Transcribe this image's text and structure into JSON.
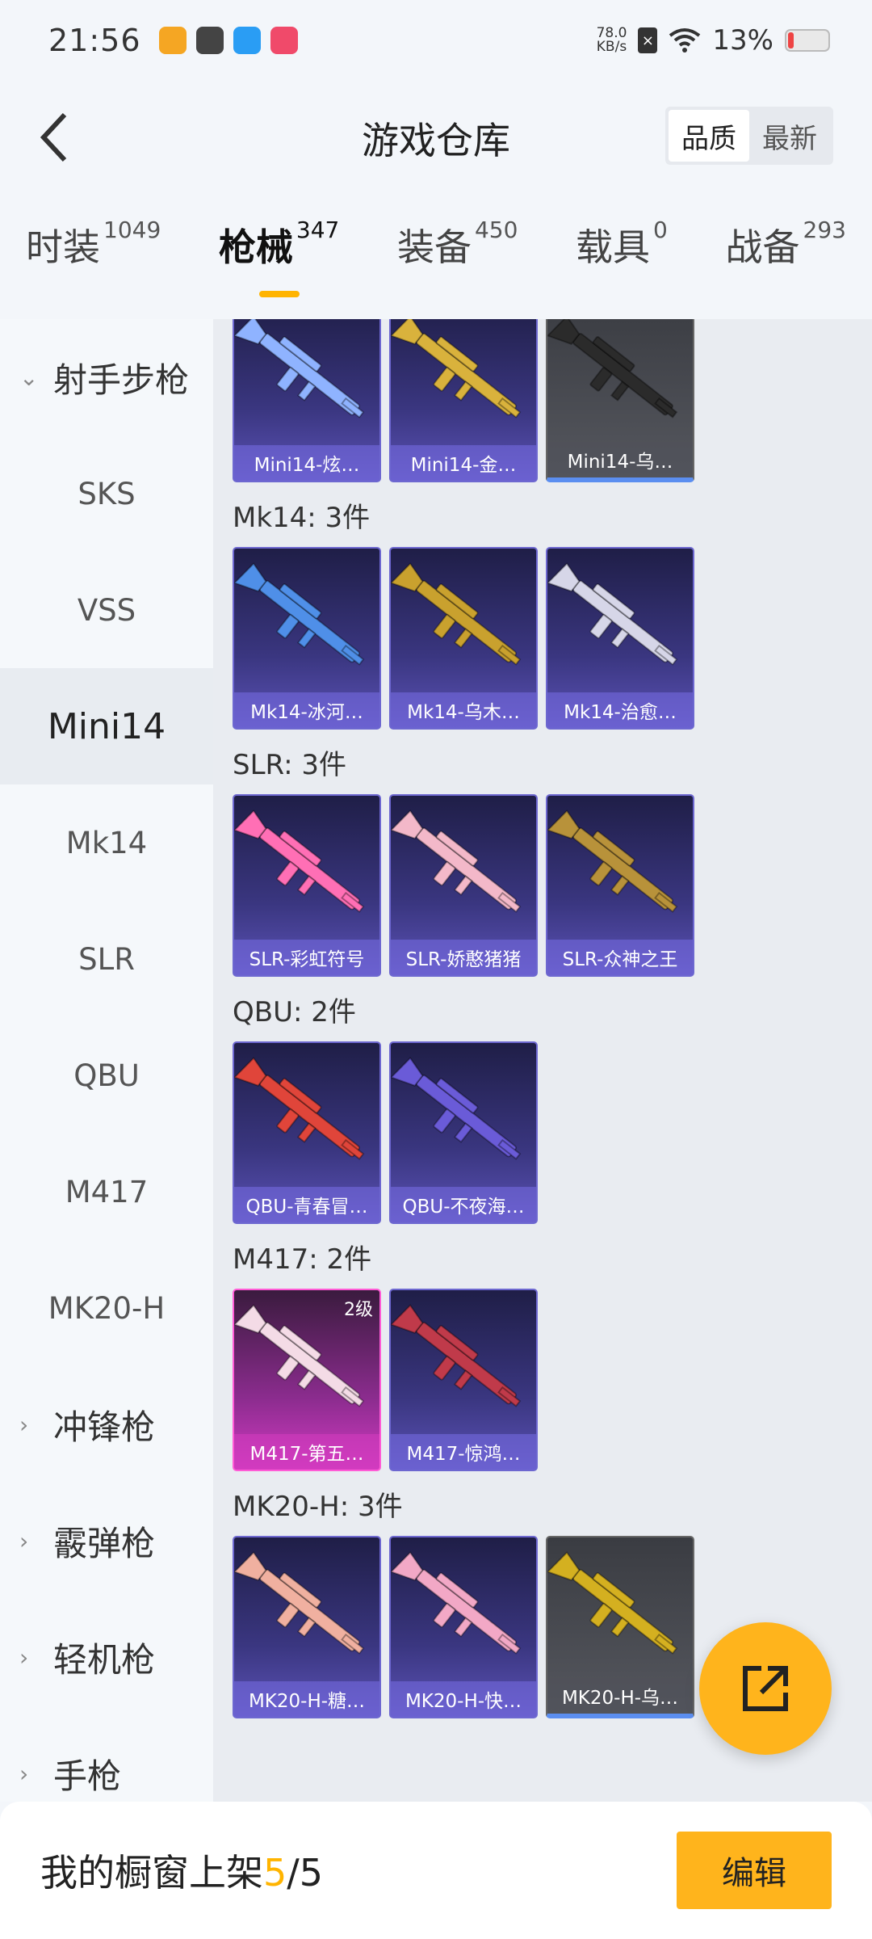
{
  "status_bar": {
    "time": "21:56",
    "net_speed_value": "78.0",
    "net_speed_unit": "KB/s",
    "sim_label": "×",
    "battery": "13%"
  },
  "header": {
    "title": "游戏仓库",
    "sort_options": [
      "品质",
      "最新"
    ],
    "sort_active": "品质"
  },
  "category_tabs": [
    {
      "label": "时装",
      "count": "1049"
    },
    {
      "label": "枪械",
      "count": "347",
      "active": true
    },
    {
      "label": "装备",
      "count": "450"
    },
    {
      "label": "载具",
      "count": "0"
    },
    {
      "label": "战备",
      "count": "293"
    }
  ],
  "sidebar": {
    "items": [
      {
        "label": "射手步枪",
        "type": "group",
        "expanded": true
      },
      {
        "label": "SKS"
      },
      {
        "label": "VSS"
      },
      {
        "label": "Mini14",
        "active": true
      },
      {
        "label": "Mk14"
      },
      {
        "label": "SLR"
      },
      {
        "label": "QBU"
      },
      {
        "label": "M417"
      },
      {
        "label": "MK20-H"
      },
      {
        "label": "冲锋枪",
        "type": "group"
      },
      {
        "label": "霰弹枪",
        "type": "group"
      },
      {
        "label": "轻机枪",
        "type": "group"
      },
      {
        "label": "手枪",
        "type": "group"
      }
    ]
  },
  "sections": [
    {
      "title": "",
      "items": [
        {
          "name": "Mini14-炫…",
          "style": "purple",
          "art": "#8fb3ff"
        },
        {
          "name": "Mini14-金…",
          "style": "purple",
          "art": "#d9b23c"
        },
        {
          "name": "Mini14-乌…",
          "style": "gray",
          "art": "#2b2b2b"
        }
      ]
    },
    {
      "title": "Mk14: 3件",
      "items": [
        {
          "name": "Mk14-冰河…",
          "style": "purple",
          "art": "#4f8fe8"
        },
        {
          "name": "Mk14-乌木…",
          "style": "purple",
          "art": "#c9a12e"
        },
        {
          "name": "Mk14-治愈…",
          "style": "purple",
          "art": "#d6d6e8"
        }
      ]
    },
    {
      "title": "SLR: 3件",
      "items": [
        {
          "name": "SLR-彩虹符号",
          "style": "purple",
          "art": "#ff6fb5"
        },
        {
          "name": "SLR-娇憨猪猪",
          "style": "purple",
          "art": "#f3b8c9"
        },
        {
          "name": "SLR-众神之王",
          "style": "purple",
          "art": "#b8923a"
        }
      ]
    },
    {
      "title": "QBU: 2件",
      "items": [
        {
          "name": "QBU-青春冒…",
          "style": "purple",
          "art": "#e0453a"
        },
        {
          "name": "QBU-不夜海…",
          "style": "purple",
          "art": "#6a5bd8"
        }
      ]
    },
    {
      "title": "M417: 2件",
      "items": [
        {
          "name": "M417-第五…",
          "style": "pink",
          "art": "#f4dbe6",
          "badge": "2级"
        },
        {
          "name": "M417-惊鸿…",
          "style": "purple",
          "art": "#c03a4a"
        }
      ]
    },
    {
      "title": "MK20-H: 3件",
      "items": [
        {
          "name": "MK20-H-糖…",
          "style": "purple",
          "art": "#f0b0a0"
        },
        {
          "name": "MK20-H-快…",
          "style": "purple",
          "art": "#f2a8c6"
        },
        {
          "name": "MK20-H-乌…",
          "style": "gray",
          "art": "#d4b020"
        }
      ]
    }
  ],
  "bottom_bar": {
    "label": "我的橱窗上架",
    "current": "5",
    "separator": "/",
    "total": "5",
    "edit_label": "编辑"
  }
}
